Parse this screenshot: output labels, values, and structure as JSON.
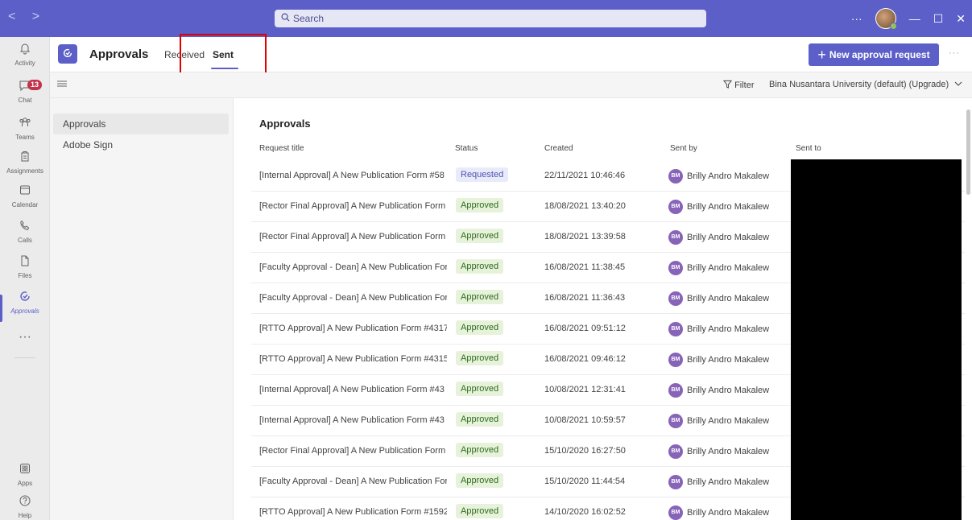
{
  "titlebar": {
    "nav_back": "<",
    "nav_forward": ">",
    "search_placeholder": "Search",
    "more": "···",
    "minimize": "—",
    "maximize": "☐",
    "close": "✕"
  },
  "rail": {
    "items": [
      {
        "label": "Activity",
        "icon": "bell-icon"
      },
      {
        "label": "Chat",
        "icon": "chat-icon",
        "badge": "13"
      },
      {
        "label": "Teams",
        "icon": "teams-icon"
      },
      {
        "label": "Assignments",
        "icon": "assignments-icon"
      },
      {
        "label": "Calendar",
        "icon": "calendar-icon"
      },
      {
        "label": "Calls",
        "icon": "phone-icon"
      },
      {
        "label": "Files",
        "icon": "file-icon"
      },
      {
        "label": "Approvals",
        "icon": "approvals-icon"
      },
      {
        "label": "···",
        "icon": "more-icon"
      }
    ],
    "bottom": [
      {
        "label": "Apps",
        "icon": "apps-icon"
      },
      {
        "label": "Help",
        "icon": "help-icon"
      }
    ]
  },
  "app": {
    "title": "Approvals",
    "tabs": [
      {
        "label": "Received"
      },
      {
        "label": "Sent"
      }
    ],
    "new_button": "New approval request",
    "more": "···"
  },
  "toolbar": {
    "filter": "Filter",
    "org": "Bina Nusantara University (default) (Upgrade)"
  },
  "leftpane": {
    "items": [
      "Approvals",
      "Adobe Sign"
    ]
  },
  "main": {
    "title": "Approvals",
    "columns": [
      "Request title",
      "Status",
      "Created",
      "Sent by",
      "Sent to"
    ],
    "rows": [
      {
        "title": "[Internal Approval] A New Publication Form #58",
        "status": "Requested",
        "created": "22/11/2021 10:46:46",
        "sent_by": "Brilly Andro Makalew"
      },
      {
        "title": "[Rector Final Approval] A New Publication Form",
        "status": "Approved",
        "created": "18/08/2021 13:40:20",
        "sent_by": "Brilly Andro Makalew"
      },
      {
        "title": "[Rector Final Approval] A New Publication Form",
        "status": "Approved",
        "created": "18/08/2021 13:39:58",
        "sent_by": "Brilly Andro Makalew"
      },
      {
        "title": "[Faculty Approval - Dean] A New Publication For",
        "status": "Approved",
        "created": "16/08/2021 11:38:45",
        "sent_by": "Brilly Andro Makalew"
      },
      {
        "title": "[Faculty Approval - Dean] A New Publication For",
        "status": "Approved",
        "created": "16/08/2021 11:36:43",
        "sent_by": "Brilly Andro Makalew"
      },
      {
        "title": "[RTTO Approval] A New Publication Form #4317",
        "status": "Approved",
        "created": "16/08/2021 09:51:12",
        "sent_by": "Brilly Andro Makalew"
      },
      {
        "title": "[RTTO Approval] A New Publication Form #4315",
        "status": "Approved",
        "created": "16/08/2021 09:46:12",
        "sent_by": "Brilly Andro Makalew"
      },
      {
        "title": "[Internal Approval] A New Publication Form #43",
        "status": "Approved",
        "created": "10/08/2021 12:31:41",
        "sent_by": "Brilly Andro Makalew"
      },
      {
        "title": "[Internal Approval] A New Publication Form #43",
        "status": "Approved",
        "created": "10/08/2021 10:59:57",
        "sent_by": "Brilly Andro Makalew"
      },
      {
        "title": "[Rector Final Approval] A New Publication Form",
        "status": "Approved",
        "created": "15/10/2020 16:27:50",
        "sent_by": "Brilly Andro Makalew"
      },
      {
        "title": "[Faculty Approval - Dean] A New Publication For",
        "status": "Approved",
        "created": "15/10/2020 11:44:54",
        "sent_by": "Brilly Andro Makalew"
      },
      {
        "title": "[RTTO Approval] A New Publication Form #1592",
        "status": "Approved",
        "created": "14/10/2020 16:02:52",
        "sent_by": "Brilly Andro Makalew"
      }
    ],
    "avatar_initials": "BM"
  },
  "colors": {
    "accent": "#5b5fc7",
    "approved_bg": "#e7f2da",
    "requested_bg": "#e8ebf9",
    "badge": "#c4314b"
  }
}
